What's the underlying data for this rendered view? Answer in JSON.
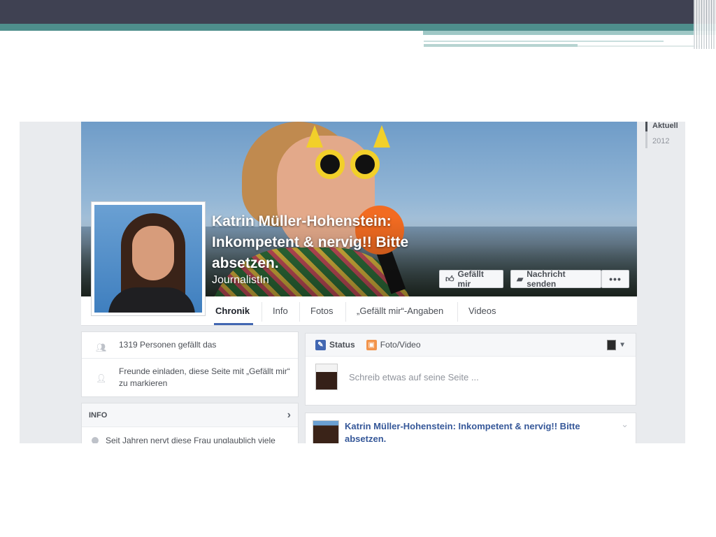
{
  "page": {
    "name": "Katrin Müller-Hohenstein: Inkompetent & nervig!! Bitte absetzen.",
    "category": "JournalistIn"
  },
  "cover_buttons": {
    "like": "Gefällt mir",
    "message": "Nachricht senden",
    "more": "•••"
  },
  "tabs": [
    "Chronik",
    "Info",
    "Fotos",
    "„Gefällt mir“-Angaben",
    "Videos"
  ],
  "active_tab": "Chronik",
  "timeline": {
    "items": [
      "Aktuell",
      "2012"
    ]
  },
  "sidebar": {
    "likes_text": "1319 Personen gefällt das",
    "invite_text": "Freunde einladen, diese Seite mit „Gefällt mir“ zu markieren",
    "info_heading": "INFO",
    "info_text": "Seit Jahren nervt diese Frau unglaublich viele Fans"
  },
  "composer": {
    "status_label": "Status",
    "photo_label": "Foto/Video",
    "placeholder": "Schreib etwas auf seine Seite ..."
  },
  "post": {
    "title": "Katrin Müller-Hohenstein: Inkompetent & nervig!! Bitte absetzen."
  },
  "colors": {
    "slide_dark": "#3f4152",
    "slide_teal": "#4e8e8c",
    "facebook_blue": "#4267b2",
    "link_blue": "#365899"
  },
  "icons": [
    "like-thumb-icon",
    "message-icon",
    "more-dots-icon",
    "people-icon",
    "invite-person-icon",
    "chevron-right-icon",
    "info-circle-icon",
    "pencil-icon",
    "photo-icon",
    "persona-dropdown-icon",
    "chevron-down-icon"
  ]
}
